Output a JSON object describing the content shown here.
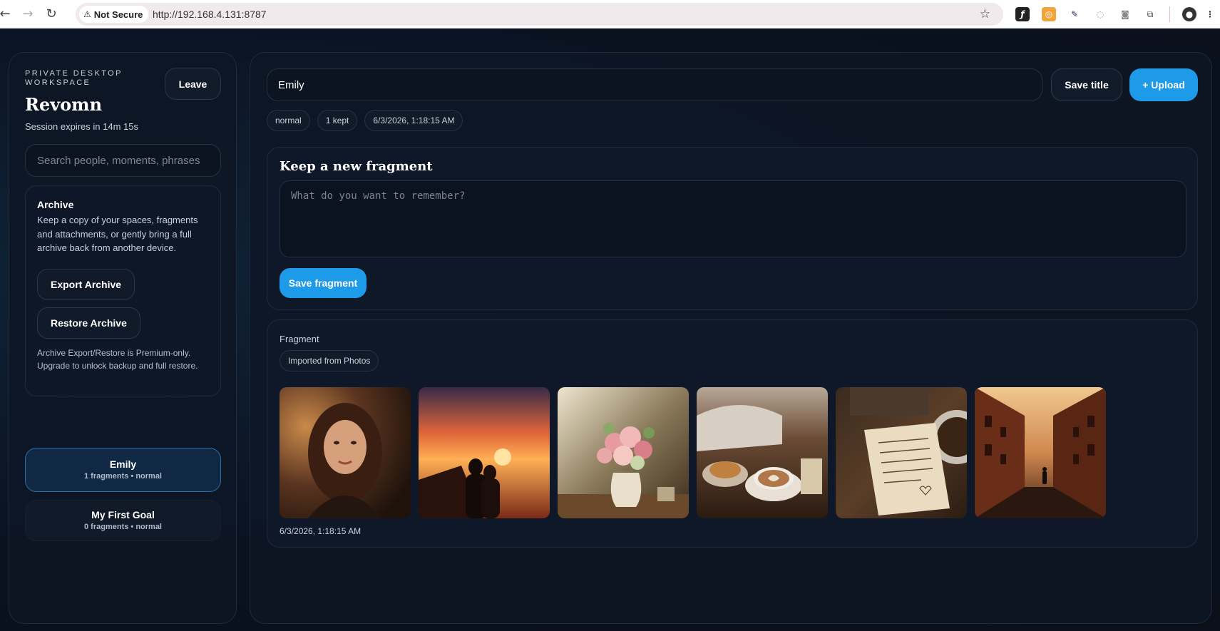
{
  "browser": {
    "security_label": "Not Secure",
    "url": "http://192.168.4.131:8787",
    "icons": [
      "back-arrow-icon",
      "forward-arrow-icon",
      "reload-icon",
      "warning-icon",
      "star-icon",
      "fx-extension-icon",
      "extension-orange-icon",
      "eyedropper-icon",
      "circle-extension-icon",
      "camera-icon",
      "puzzle-icon",
      "profile-avatar-icon",
      "kebab-menu-icon"
    ]
  },
  "sidebar": {
    "eyebrow": "PRIVATE DESKTOP WORKSPACE",
    "leave_label": "Leave",
    "brand": "Revomn",
    "session": "Session expires in 14m 15s",
    "search_placeholder": "Search people, moments, phrases",
    "archive": {
      "title": "Archive",
      "description": "Keep a copy of your spaces, fragments and attachments, or gently bring a full archive back from another device.",
      "export_label": "Export Archive",
      "restore_label": "Restore Archive",
      "note": "Archive Export/Restore is Premium-only. Upgrade to unlock backup and full restore."
    },
    "spaces": [
      {
        "name": "Emily",
        "meta": "1 fragments • normal",
        "active": true
      },
      {
        "name": "My First Goal",
        "meta": "0 fragments • normal",
        "active": false
      }
    ]
  },
  "main": {
    "title_value": "Emily",
    "save_title_label": "Save title",
    "upload_label": "+ Upload",
    "chips": [
      "normal",
      "1 kept",
      "6/3/2026, 1:18:15 AM"
    ],
    "composer": {
      "title": "Keep a new fragment",
      "placeholder": "What do you want to remember?",
      "save_label": "Save fragment"
    },
    "fragment": {
      "label": "Fragment",
      "source": "Imported from Photos",
      "photos": [
        "portrait-woman",
        "sunset-couple",
        "flower-vase",
        "coffee-croissant",
        "handwritten-note",
        "evening-street"
      ],
      "timestamp": "6/3/2026, 1:18:15 AM"
    }
  },
  "colors": {
    "accent": "#1e9be8",
    "background": "#0b1220",
    "panel": "#0e1727",
    "active_space": "#112845"
  }
}
